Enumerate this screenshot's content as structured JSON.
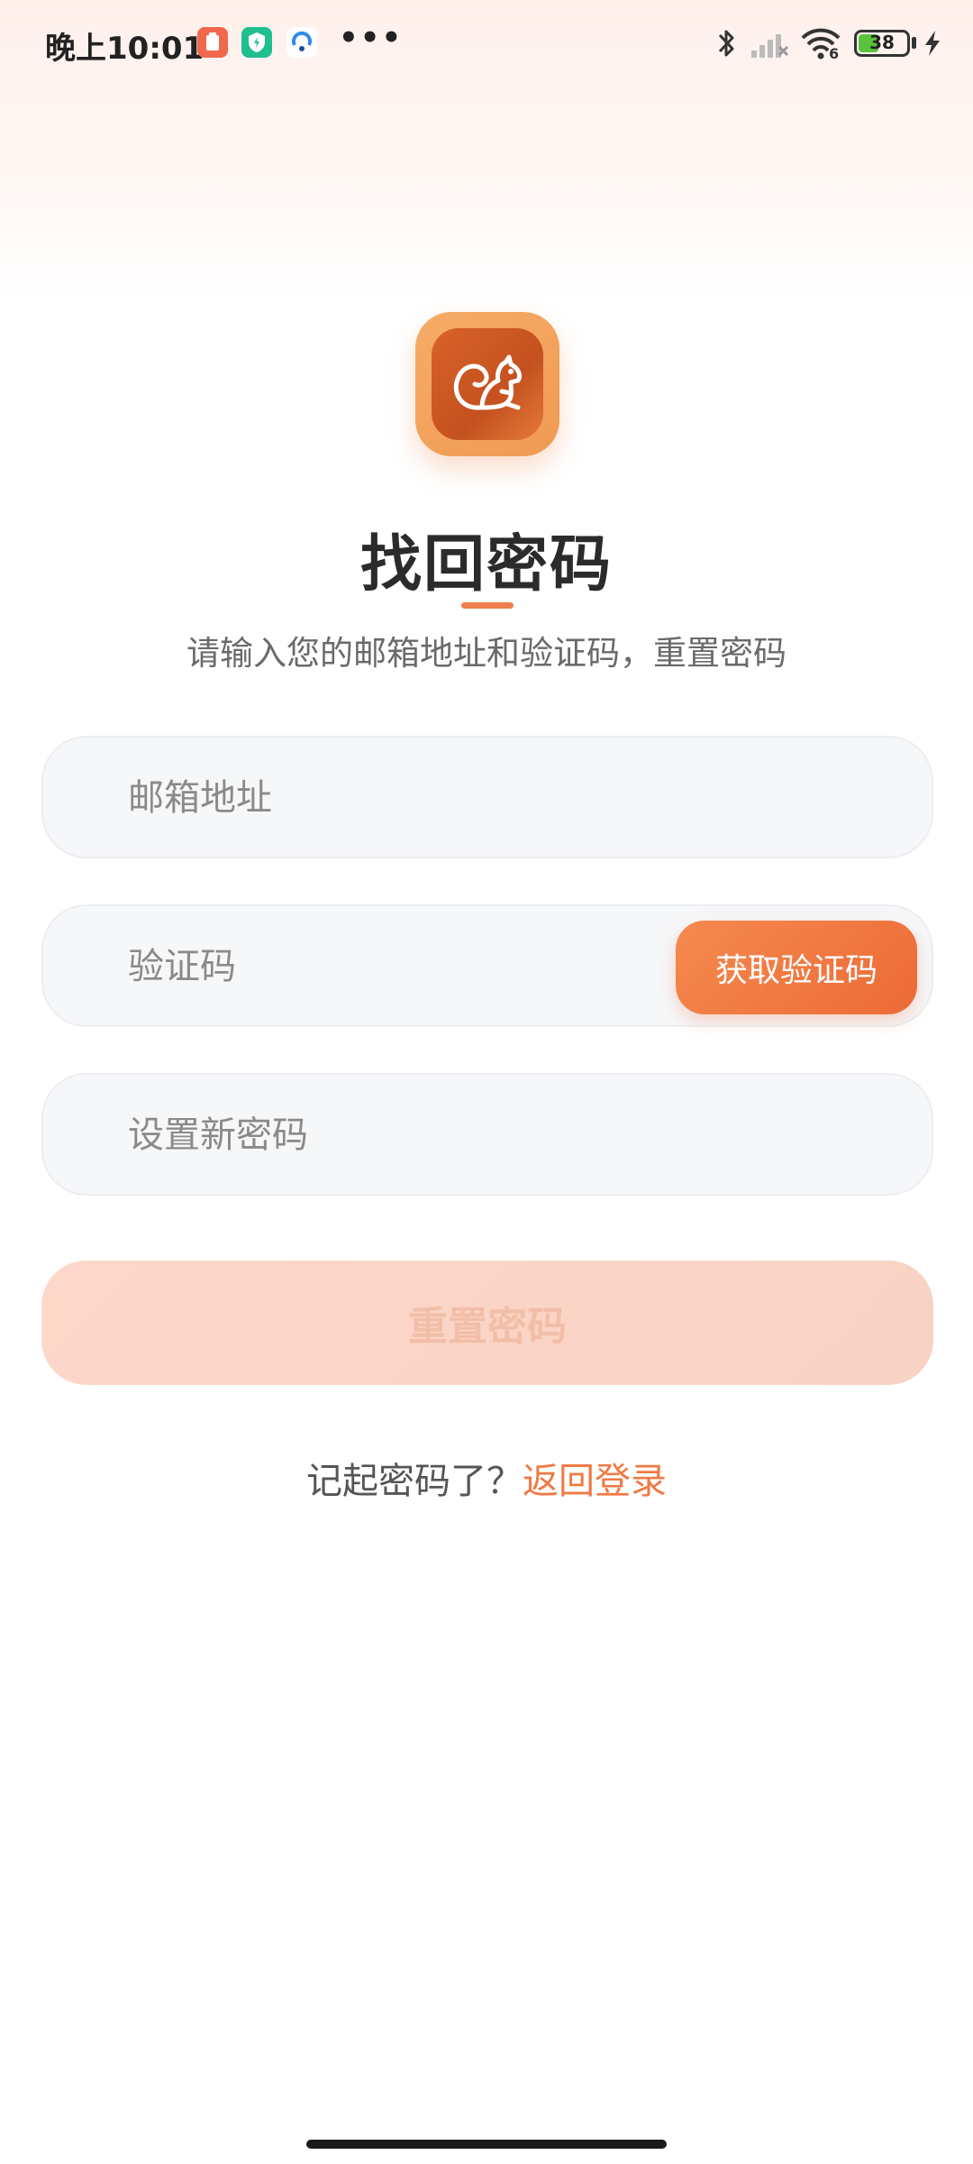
{
  "status_bar": {
    "time": "晚上10:01",
    "wifi_label": "6",
    "battery_level": "38"
  },
  "colors": {
    "accent": "#ef7a45",
    "button_gradient_start": "#f58a4f",
    "button_gradient_end": "#ec6a36",
    "disabled_button": "#fbd6c8"
  },
  "header": {
    "title": "找回密码",
    "subtitle": "请输入您的邮箱地址和验证码，重置密码"
  },
  "form": {
    "email_placeholder": "邮箱地址",
    "code_placeholder": "验证码",
    "get_code_label": "获取验证码",
    "password_placeholder": "设置新密码",
    "reset_label": "重置密码"
  },
  "footer": {
    "prompt": "记起密码了？",
    "back_link": "返回登录"
  },
  "icons": {
    "app_logo": "squirrel-icon"
  }
}
